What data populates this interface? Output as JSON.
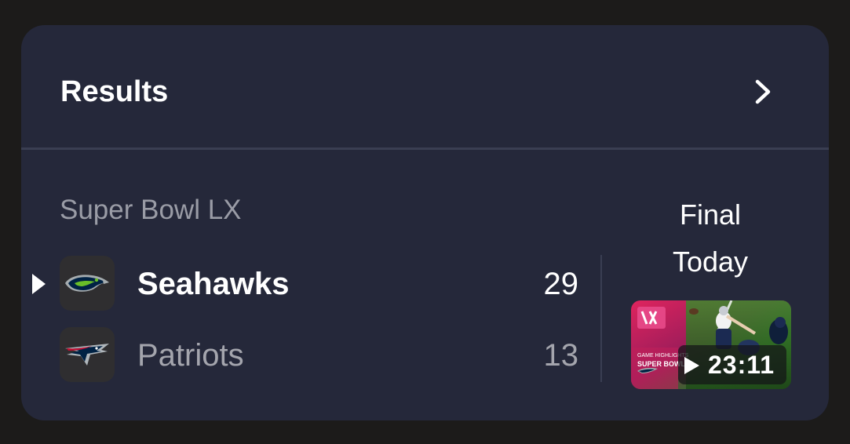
{
  "header": {
    "title": "Results",
    "chevron_icon": "chevron-right-icon"
  },
  "event": {
    "title": "Super Bowl LX",
    "status": "Final",
    "date": "Today"
  },
  "teams": [
    {
      "name": "Seahawks",
      "score": "29",
      "winner": true,
      "logo_icon": "seahawks-logo-icon",
      "colors": {
        "primary": "#002244",
        "secondary": "#69be28",
        "accent": "#a5acaf"
      }
    },
    {
      "name": "Patriots",
      "score": "13",
      "winner": false,
      "logo_icon": "patriots-logo-icon",
      "colors": {
        "primary": "#002244",
        "secondary": "#c60c30",
        "accent": "#b0b7bc"
      }
    }
  ],
  "highlight": {
    "duration": "23:11",
    "caption_line1": "GAME HIGHLIGHTS",
    "caption_line2": "SUPER BOWL",
    "play_icon": "play-icon",
    "badge_text": "LX"
  },
  "colors": {
    "page_background": "#1c1b1a",
    "card_background": "#25283a",
    "divider": "#3a3e52",
    "text_primary": "#ffffff",
    "text_secondary": "#9a9ca6"
  }
}
